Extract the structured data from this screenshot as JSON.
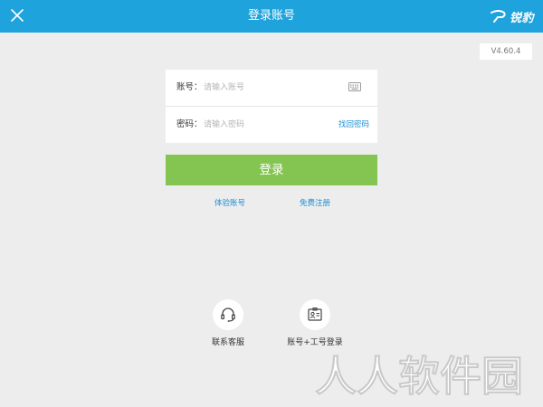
{
  "header": {
    "title": "登录账号",
    "brand_name": "锐豹",
    "background_color": "#1fa3dc"
  },
  "version": "V4.60.4",
  "form": {
    "account_label": "账号：",
    "account_placeholder": "请输入账号",
    "password_label": "密码：",
    "password_placeholder": "请输入密码",
    "forgot_password": "找回密码"
  },
  "login_button": {
    "label": "登录",
    "color": "#84c451"
  },
  "links": {
    "trial_account": "体验账号",
    "free_register": "免费注册"
  },
  "quick_actions": {
    "contact_support": "联系客服",
    "staff_login": "账号+工号登录"
  },
  "watermark": "人人软件园"
}
